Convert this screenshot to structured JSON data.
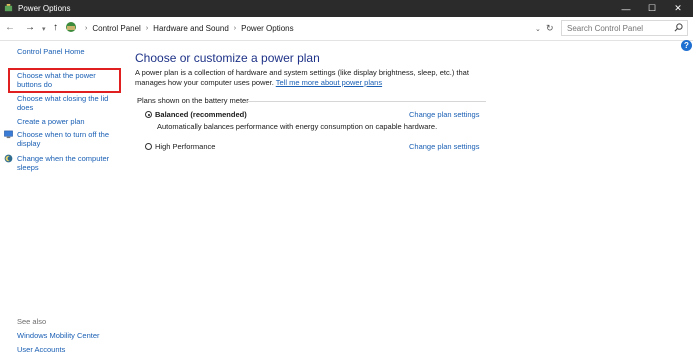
{
  "window": {
    "title": "Power Options",
    "minimize_glyph": "—",
    "maximize_glyph": "☐",
    "close_glyph": "✕"
  },
  "address_bar": {
    "breadcrumbs": [
      "Control Panel",
      "Hardware and Sound",
      "Power Options"
    ],
    "search_placeholder": "Search Control Panel"
  },
  "left_pane": {
    "home": "Control Panel Home",
    "items": [
      {
        "label": "Choose what the power buttons do",
        "highlighted": true
      },
      {
        "label": "Choose what closing the lid does"
      },
      {
        "label": "Create a power plan"
      },
      {
        "label": "Choose when to turn off the display",
        "icon": "display-icon"
      },
      {
        "label": "Change when the computer sleeps",
        "icon": "sleep-icon"
      }
    ],
    "see_also": "See also",
    "see_also_links": [
      "Windows Mobility Center",
      "User Accounts"
    ]
  },
  "main": {
    "heading": "Choose or customize a power plan",
    "description": "A power plan is a collection of hardware and system settings (like display brightness, sleep, etc.) that manages how your computer uses power.",
    "description_link": "Tell me more about power plans",
    "section_label": "Plans shown on the battery meter",
    "plans": [
      {
        "name": "Balanced (recommended)",
        "selected": true,
        "description": "Automatically balances performance with energy consumption on capable hardware.",
        "change_link": "Change plan settings"
      },
      {
        "name": "High Performance",
        "selected": false,
        "change_link": "Change plan settings"
      }
    ]
  },
  "colors": {
    "titlebar": "#2b2b2b",
    "link": "#1a5fb4",
    "heading": "#1e3287",
    "highlight_box": "#e02020"
  }
}
